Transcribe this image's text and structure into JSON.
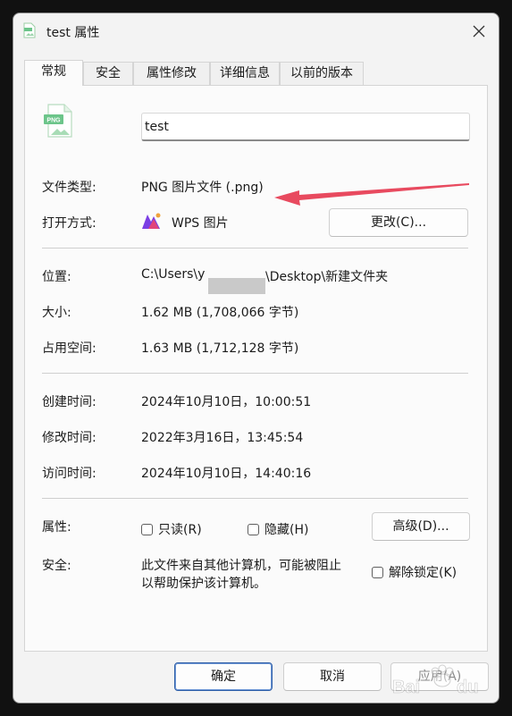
{
  "window": {
    "title": "test 属性",
    "close_icon": "close-icon"
  },
  "tabs": [
    {
      "label": "常规",
      "active": true
    },
    {
      "label": "安全",
      "active": false
    },
    {
      "label": "属性修改",
      "active": false
    },
    {
      "label": "详细信息",
      "active": false
    },
    {
      "label": "以前的版本",
      "active": false
    }
  ],
  "file": {
    "icon_label": "PNG",
    "name": "test"
  },
  "type_info": {
    "label": "文件类型:",
    "value": "PNG 图片文件 (.png)"
  },
  "open_with": {
    "label": "打开方式:",
    "app": "WPS 图片",
    "change_button": "更改(C)..."
  },
  "location": {
    "label": "位置:",
    "value_prefix": "C:\\Users\\y",
    "value_suffix": "\\Desktop\\新建文件夹"
  },
  "size": {
    "label": "大小:",
    "value": "1.62 MB (1,708,066 字节)"
  },
  "size_on_disk": {
    "label": "占用空间:",
    "value": "1.63 MB (1,712,128 字节)"
  },
  "created": {
    "label": "创建时间:",
    "value": "2024年10月10日，10:00:51"
  },
  "modified": {
    "label": "修改时间:",
    "value": "2022年3月16日，13:45:54"
  },
  "accessed": {
    "label": "访问时间:",
    "value": "2024年10月10日，14:40:16"
  },
  "attributes": {
    "label": "属性:",
    "readonly": "只读(R)",
    "hidden": "隐藏(H)",
    "advanced_button": "高级(D)..."
  },
  "security": {
    "label": "安全:",
    "line1": "此文件来自其他计算机，可能被阻止",
    "line2": "以帮助保护该计算机。",
    "unblock": "解除锁定(K)"
  },
  "footer": {
    "ok": "确定",
    "cancel": "取消",
    "apply": "应用(A)"
  },
  "colors": {
    "arrow": "#e84a5f",
    "accent": "#2f5fa8"
  }
}
